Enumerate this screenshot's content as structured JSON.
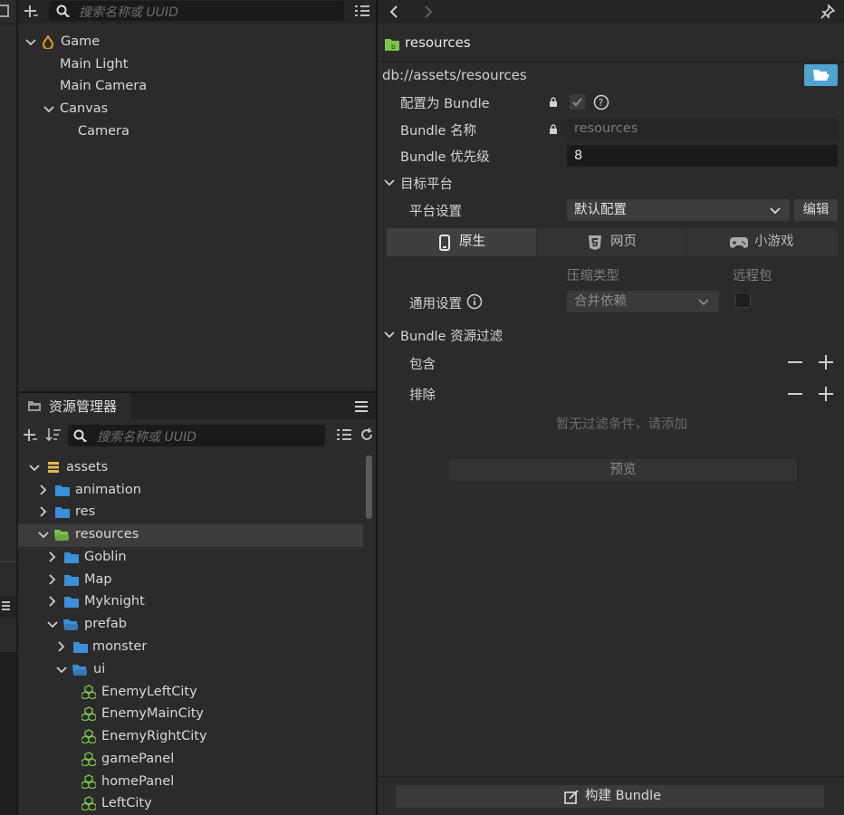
{
  "hierarchy": {
    "search_placeholder": "搜索名称或 UUID",
    "nodes": [
      "Game",
      "Main Light",
      "Main Camera",
      "Canvas",
      "Camera"
    ]
  },
  "assets_panel": {
    "tab_label": "资源管理器",
    "search_placeholder": "搜索名称或 UUID",
    "tree": {
      "assets": "assets",
      "animation": "animation",
      "res": "res",
      "resources": "resources",
      "goblin": "Goblin",
      "map": "Map",
      "myknight": "Myknight",
      "prefab": "prefab",
      "monster": "monster",
      "ui": "ui",
      "enemy_left_city": "EnemyLeftCity",
      "enemy_main_city": "EnemyMainCity",
      "enemy_right_city": "EnemyRightCity",
      "game_panel": "gamePanel",
      "home_panel": "homePanel",
      "left_city": "LeftCity"
    }
  },
  "inspector": {
    "title": "resources",
    "path": "db://assets/resources",
    "config_bundle_label": "配置为 Bundle",
    "bundle_name_label": "Bundle 名称",
    "bundle_name_value": "resources",
    "bundle_priority_label": "Bundle 优先级",
    "bundle_priority_value": "8",
    "target_platform_label": "目标平台",
    "platform_settings_label": "平台设置",
    "platform_select_value": "默认配置",
    "edit_button": "编辑",
    "tabs": [
      "原生",
      "网页",
      "小游戏"
    ],
    "compress_type_header": "压缩类型",
    "remote_bundle_header": "远程包",
    "general_settings_label": "通用设置",
    "compress_select_value": "合并依赖",
    "filter_section_label": "Bundle 资源过滤",
    "include_label": "包含",
    "exclude_label": "排除",
    "empty_filter_text": "暂无过滤条件，请添加",
    "preview_button": "预览",
    "build_button": "构建 Bundle"
  },
  "colors": {
    "accent_folder_green": "#7bc24a",
    "folder_blue": "#3b8fd8",
    "open_button_blue": "#4fa3cf",
    "game_icon_orange": "#e0962a"
  }
}
